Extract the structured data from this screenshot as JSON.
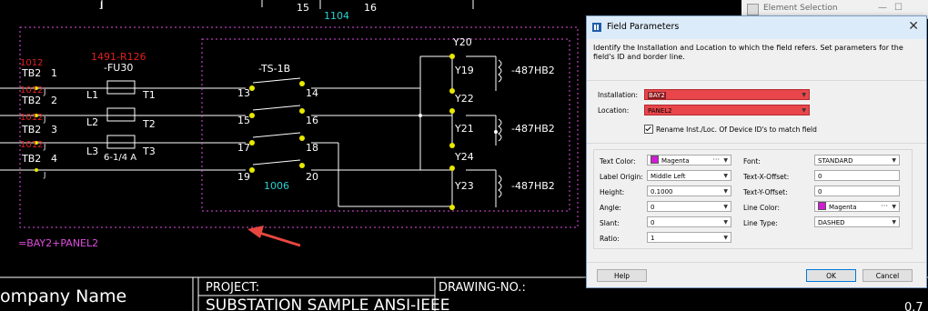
{
  "cad": {
    "top_numbers": [
      "15",
      "1104",
      "16"
    ],
    "left_refs": [
      "1012",
      "1012",
      "1012",
      "1012"
    ],
    "tb_labels": [
      "TB2",
      "TB2",
      "TB2",
      "TB2"
    ],
    "tb_numbers": [
      "1",
      "2",
      "3",
      "4"
    ],
    "j_letters": [
      "J",
      "J",
      "J",
      "J",
      "J"
    ],
    "fuse_ref": "1491-R126",
    "fuse_tag": "-FU30",
    "fuse_rating": "6-1/4 A",
    "line_labels": [
      "L1",
      "L2",
      "L3"
    ],
    "t_labels": [
      "T1",
      "T2",
      "T3"
    ],
    "switch_tag": "-TS-1B",
    "switch_left": [
      "13",
      "15",
      "17",
      "19"
    ],
    "switch_right": [
      "14",
      "16",
      "18",
      "20"
    ],
    "switch_ref": "1006",
    "y_labels": [
      "Y20",
      "Y19",
      "Y22",
      "Y21",
      "Y24",
      "Y23"
    ],
    "hb_labels": [
      "-487HB2",
      "-487HB2",
      "-487HB2"
    ],
    "field_label": "=BAY2+PANEL2",
    "company": "ompany Name",
    "project_label": "PROJECT:",
    "project_name": "SUBSTATION SAMPLE ANSI-IEEE",
    "drawing_label": "DRAWING-NO.:",
    "drawing_frag": "0.7",
    "colors": {
      "magenta": "#e04ce0",
      "red": "#e02020",
      "yellow": "#e8e800",
      "cyan": "#2ad0d0",
      "white": "#ffffff",
      "arrow": "#e8473f"
    }
  },
  "background_window": {
    "title": "Element Selection"
  },
  "dialog": {
    "title": "Field Parameters",
    "description": "Identify the Installation and Location to which the field refers. Set parameters for the field's ID and border line.",
    "installation_label": "Installation:",
    "installation_value": "BAY2",
    "location_label": "Location:",
    "location_value": "PANEL2",
    "rename_label": "Rename Inst./Loc. Of Device ID's to match field",
    "rename_checked": true,
    "left": {
      "text_color_label": "Text Color:",
      "text_color_value": "Magenta",
      "label_origin_label": "Label Origin:",
      "label_origin_value": "Middle Left",
      "height_label": "Height:",
      "height_value": "0.1000",
      "angle_label": "Angle:",
      "angle_value": "0",
      "slant_label": "Slant:",
      "slant_value": "0",
      "ratio_label": "Ratio:",
      "ratio_value": "1"
    },
    "right": {
      "font_label": "Font:",
      "font_value": "STANDARD",
      "text_x_label": "Text-X-Offset:",
      "text_x_value": "0",
      "text_y_label": "Text-Y-Offset:",
      "text_y_value": "0",
      "line_color_label": "Line Color:",
      "line_color_value": "Magenta",
      "line_type_label": "Line Type:",
      "line_type_value": "DASHED"
    },
    "help_label": "Help",
    "ok_label": "OK",
    "cancel_label": "Cancel",
    "swatch_color": "#d11cd6",
    "highlight_color": "#e8464b"
  }
}
